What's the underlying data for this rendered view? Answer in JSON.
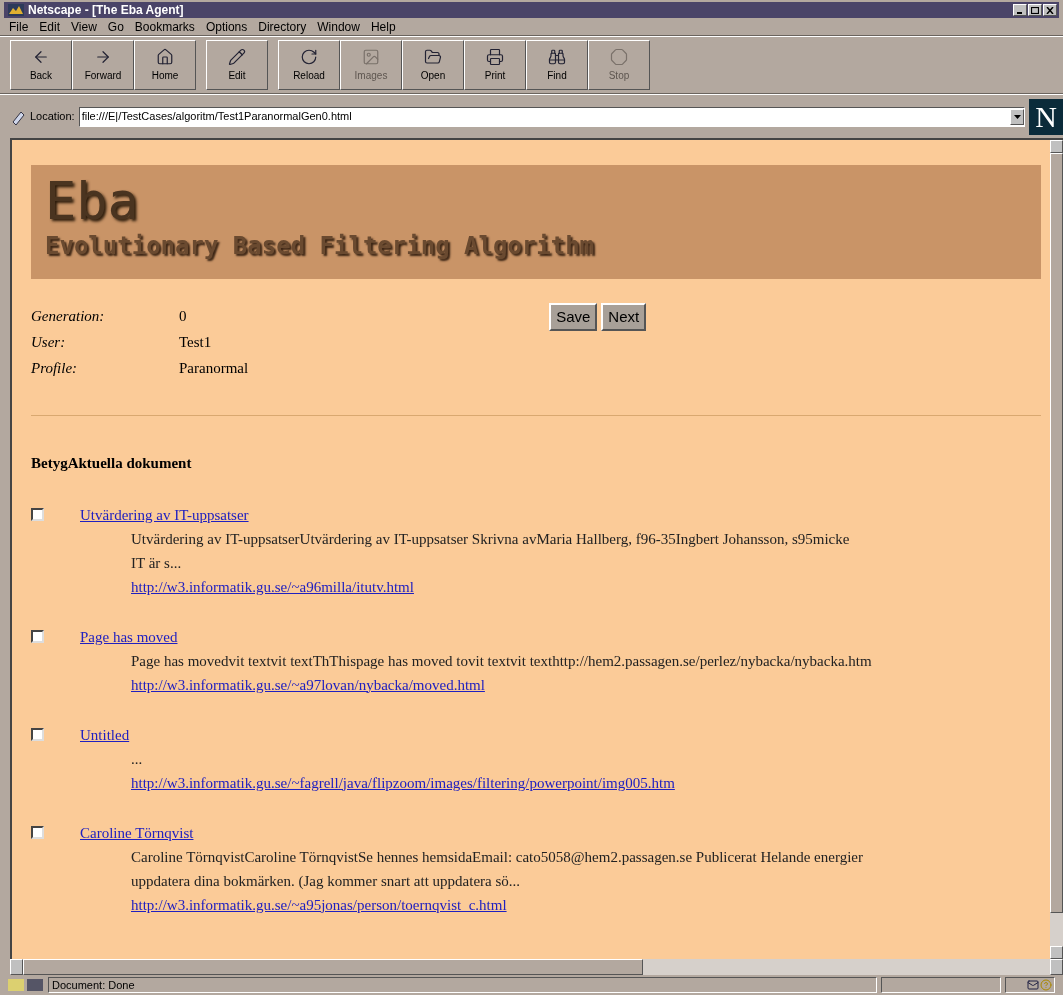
{
  "window": {
    "title": "Netscape - [The Eba Agent]"
  },
  "menu": [
    "File",
    "Edit",
    "View",
    "Go",
    "Bookmarks",
    "Options",
    "Directory",
    "Window",
    "Help"
  ],
  "toolbar": [
    {
      "kind": "back",
      "label": "Back",
      "disabled": false
    },
    {
      "kind": "forward",
      "label": "Forward",
      "disabled": false
    },
    {
      "kind": "home",
      "label": "Home",
      "disabled": false
    },
    {
      "kind": "edit",
      "label": "Edit",
      "disabled": false
    },
    {
      "kind": "reload",
      "label": "Reload",
      "disabled": false
    },
    {
      "kind": "images",
      "label": "Images",
      "disabled": true
    },
    {
      "kind": "open",
      "label": "Open",
      "disabled": false
    },
    {
      "kind": "print",
      "label": "Print",
      "disabled": false
    },
    {
      "kind": "find",
      "label": "Find",
      "disabled": false
    },
    {
      "kind": "stop",
      "label": "Stop",
      "disabled": true
    }
  ],
  "location": {
    "label": "Location:",
    "value": "file:///E|/TestCases/algoritm/Test1ParanormalGen0.html"
  },
  "logo_letter": "N",
  "page": {
    "banner_title": "Eba",
    "banner_subtitle": "Evolutionary Based Filtering Algorithm",
    "info": [
      {
        "label": "Generation:",
        "value": "0"
      },
      {
        "label": "User:",
        "value": "Test1"
      },
      {
        "label": "Profile:",
        "value": "Paranormal"
      }
    ],
    "buttons": [
      "Save",
      "Next"
    ],
    "heading": "BetygAktuella dokument",
    "documents": [
      {
        "checked": false,
        "title": "Utvärdering av IT-uppsatser",
        "lines": [
          "Utvärdering av IT-uppsatserUtvärdering av IT-uppsatser Skrivna avMaria Hallberg, f96-35Ingbert Johansson, s95micke",
          "IT är s..."
        ],
        "url": "http://w3.informatik.gu.se/~a96milla/itutv.html"
      },
      {
        "checked": false,
        "title": "Page has moved",
        "lines": [
          "Page has movedvit textvit textThThispage has moved tovit textvit texthttp://hem2.passagen.se/perlez/nybacka/nybacka.htm"
        ],
        "url": "http://w3.informatik.gu.se/~a97lovan/nybacka/moved.html"
      },
      {
        "checked": false,
        "title": "Untitled",
        "lines": [
          "..."
        ],
        "url": "http://w3.informatik.gu.se/~fagrell/java/flipzoom/images/filtering/powerpoint/img005.htm"
      },
      {
        "checked": false,
        "title": "Caroline Törnqvist",
        "lines": [
          "Caroline TörnqvistCaroline TörnqvistSe hennes hemsidaEmail: cato5058@hem2.passagen.se Publicerat Helande energier",
          "uppdatera dina bokmärken. (Jag kommer snart att uppdatera sö..."
        ],
        "url": "http://w3.informatik.gu.se/~a95jonas/person/toernqvist_c.html"
      }
    ]
  },
  "status_bar": {
    "text": "Document: Done"
  }
}
